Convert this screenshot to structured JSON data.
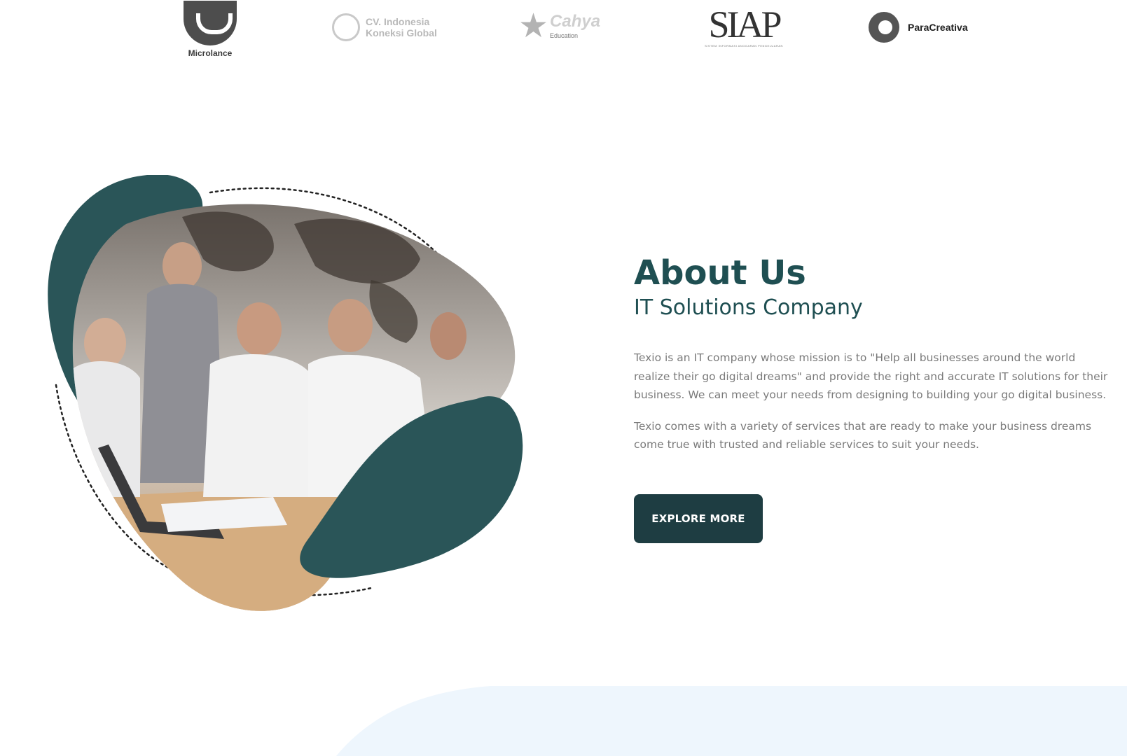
{
  "partners": {
    "microlance": "Microlance",
    "cv_indonesia_line1": "CV. Indonesia",
    "cv_indonesia_line2": "Koneksi Global",
    "cahya_main": "Cahya",
    "cahya_sub": "Education",
    "siap_main": "SIAP",
    "siap_sub": "SISTEM INFORMASI ANGGARAN PENGELUARAN",
    "paracreativa": "ParaCreativa"
  },
  "about": {
    "title": "About Us",
    "subtitle": "IT Solutions Company",
    "paragraph1": "Texio is an IT company whose mission is to \"Help all businesses around the world realize their go digital dreams\" and provide the right and accurate IT solutions for their business. We can meet your needs from designing to building your go digital business.",
    "paragraph2": "Texio comes with a variety of services that are ready to make your business dreams come true with trusted and reliable services to suit your needs.",
    "button_label": "EXPLORE MORE"
  },
  "colors": {
    "accent": "#2a5558",
    "button": "#1e3d42",
    "heading": "#1f4f52",
    "body_text": "#7a7a7a",
    "wave": "#eef6fd"
  }
}
